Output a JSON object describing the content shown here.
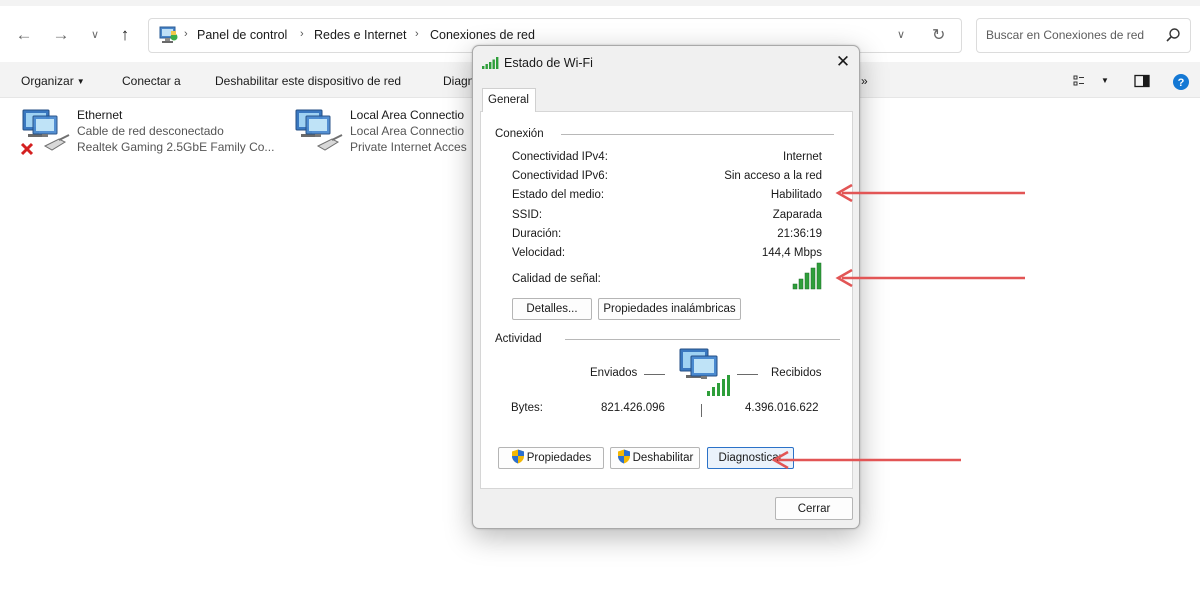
{
  "explorer": {
    "breadcrumbs": [
      "Panel de control",
      "Redes e Internet",
      "Conexiones de red"
    ],
    "search_placeholder": "Buscar en Conexiones de red",
    "commands": {
      "organize": "Organizar",
      "connect": "Conectar a",
      "disable": "Deshabilitar este dispositivo de red",
      "diagnose_partial": "Diagn",
      "more": "»"
    },
    "items": [
      {
        "name": "Ethernet",
        "status": "Cable de red desconectado",
        "device": "Realtek Gaming 2.5GbE Family Co...",
        "error": true
      },
      {
        "name": "Local Area Connectio",
        "status": "Local Area Connectio",
        "device": "Private Internet Acces",
        "error": false
      }
    ]
  },
  "dialog": {
    "title": "Estado de Wi-Fi",
    "tab": "General",
    "connection_group": "Conexión",
    "rows": [
      {
        "label": "Conectividad IPv4:",
        "value": "Internet"
      },
      {
        "label": "Conectividad IPv6:",
        "value": "Sin acceso a la red"
      },
      {
        "label": "Estado del medio:",
        "value": "Habilitado"
      },
      {
        "label": "SSID:",
        "value": "Zaparada"
      },
      {
        "label": "Duración:",
        "value": "21:36:19"
      },
      {
        "label": "Velocidad:",
        "value": "144,4 Mbps"
      }
    ],
    "signal_label": "Calidad de señal:",
    "signal_bars": 5,
    "signal_bars_total": 5,
    "details_button": "Detalles...",
    "wireless_props_button": "Propiedades inalámbricas",
    "activity_group": "Actividad",
    "sent_label": "Enviados",
    "received_label": "Recibidos",
    "bytes_label": "Bytes:",
    "bytes_sent": "821.426.096",
    "bytes_received": "4.396.016.622",
    "properties_button": "Propiedades",
    "disable_button": "Deshabilitar",
    "diagnose_button": "Diagnosticar",
    "close_button": "Cerrar"
  },
  "colors": {
    "signal_green": "#2e9e3a",
    "arrow_red": "#e25555",
    "focus_blue": "#2b72c8",
    "help_blue": "#1478d4"
  }
}
